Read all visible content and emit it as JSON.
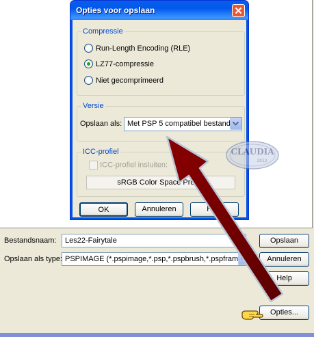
{
  "options_dialog": {
    "title": "Opties voor opslaan",
    "compression": {
      "group_title": "Compressie",
      "options": [
        {
          "label": "Run-Length Encoding (RLE)",
          "selected": false
        },
        {
          "label": "LZ77-compressie",
          "selected": true
        },
        {
          "label": "Niet gecomprimeerd",
          "selected": false
        }
      ]
    },
    "version": {
      "group_title": "Versie",
      "save_as_label": "Opslaan als:",
      "save_as_value": "Met PSP 5 compatibel bestand"
    },
    "icc": {
      "group_title": "ICC-profiel",
      "embed_label": "ICC-profiel insluiten:",
      "profile_button": "sRGB Color Space Profile"
    },
    "ok_label": "OK",
    "cancel_label": "Annuleren",
    "help_label": "Help"
  },
  "save_dialog": {
    "filename_label": "Bestandsnaam:",
    "filename_value": "Les22-Fairytale",
    "type_label": "Opslaan als type:",
    "type_value": "PSPIMAGE (*.pspimage,*.psp,*.pspbrush,*.pspframe,*",
    "save_label": "Opslaan",
    "cancel_label": "Annuleren",
    "help_label": "Help",
    "options_label": "Opties..."
  },
  "watermark": {
    "text": "CLAUDIA",
    "year": "2012"
  },
  "colors": {
    "titlebar": "#0054e3",
    "arrow": "#7a0000",
    "group_title": "#0046d5"
  }
}
